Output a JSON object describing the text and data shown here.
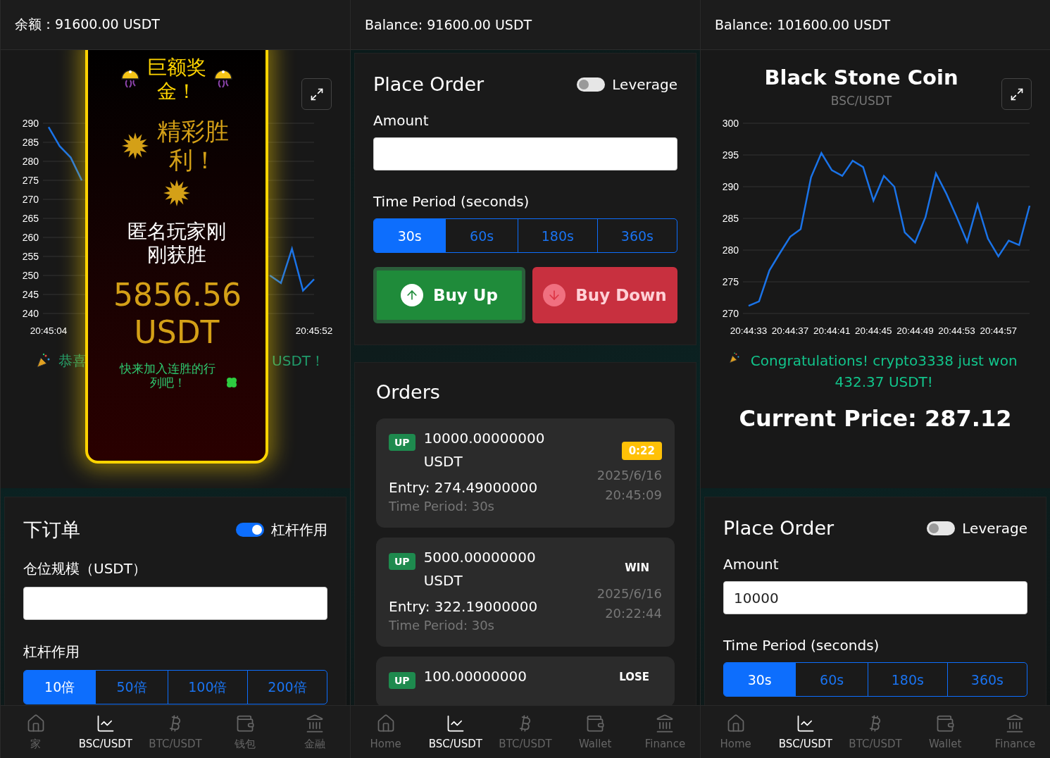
{
  "screens": [
    {
      "balance": "余额：91600.00 USDT",
      "market": {
        "chart_data": {
          "type": "line",
          "categories": [
            "20:45:04",
            null,
            null,
            null,
            null,
            null,
            null,
            null,
            null,
            null,
            null,
            null,
            null,
            null,
            null,
            null,
            null,
            null,
            null,
            null,
            null,
            null,
            null,
            null,
            "20:45:52"
          ],
          "series": [
            {
              "color": "#1a73e8",
              "values": [
                289,
                284,
                281,
                275,
                null,
                null,
                null,
                null,
                null,
                null,
                null,
                null,
                null,
                null,
                null,
                null,
                null,
                null,
                null,
                null,
                250,
                248,
                257,
                246,
                249
              ]
            }
          ],
          "grid": true,
          "ylim": [
            240,
            290
          ],
          "yticks": [
            240,
            245,
            250,
            255,
            260,
            265,
            270,
            275,
            280,
            285,
            290
          ]
        },
        "ticker": {
          "left": "恭喜",
          "right": "USDT！"
        }
      },
      "celebration": {
        "headline": "巨额奖金！",
        "subhead": "精彩胜利！",
        "message": "匿名玩家刚刚获胜",
        "amount": "5856.56 USDT",
        "cta": "快来加入连胜的行列吧！"
      },
      "order_form": {
        "title": "下订单",
        "toggle": {
          "label": "杠杆作用",
          "on": true
        },
        "amount_label": "仓位规模（USDT）",
        "options_label": "杠杆作用",
        "options": [
          {
            "label": "10倍",
            "selected": true
          },
          {
            "label": "50倍",
            "selected": false
          },
          {
            "label": "100倍",
            "selected": false
          },
          {
            "label": "200倍",
            "selected": false
          }
        ]
      },
      "nav": [
        {
          "label": "家",
          "selected": false
        },
        {
          "label": "BSC/USDT",
          "selected": true
        },
        {
          "label": "BTC/USDT",
          "selected": false
        },
        {
          "label": "钱包",
          "selected": false
        },
        {
          "label": "金融",
          "selected": false
        }
      ]
    },
    {
      "balance": "Balance: 91600.00 USDT",
      "order_form": {
        "title": "Place Order",
        "toggle": {
          "label": "Leverage",
          "on": false
        },
        "amount_label": "Amount",
        "options_label": "Time Period (seconds)",
        "options": [
          {
            "label": "30s",
            "selected": true
          },
          {
            "label": "60s",
            "selected": false
          },
          {
            "label": "180s",
            "selected": false
          },
          {
            "label": "360s",
            "selected": false
          }
        ],
        "actions": [
          {
            "label": "Buy Up",
            "kind": "up",
            "disabled": false
          },
          {
            "label": "Buy Down",
            "kind": "down",
            "disabled": true
          }
        ]
      },
      "orders": {
        "title": "Orders",
        "items": [
          {
            "direction": "UP",
            "amount": "10000.00000000 USDT",
            "entry": "Entry: 274.49000000",
            "period": "Time Period: 30s",
            "status": "0:22",
            "kind": "timer",
            "date": "2025/6/16",
            "time": "20:45:09"
          },
          {
            "direction": "UP",
            "amount": "5000.00000000 USDT",
            "entry": "Entry: 322.19000000",
            "period": "Time Period: 30s",
            "status": "WIN",
            "kind": "result",
            "date": "2025/6/16",
            "time": "20:22:44"
          },
          {
            "direction": "UP",
            "amount": "100.00000000",
            "status": "LOSE",
            "kind": "result"
          }
        ]
      },
      "nav": [
        {
          "label": "Home",
          "selected": false
        },
        {
          "label": "BSC/USDT",
          "selected": true
        },
        {
          "label": "BTC/USDT",
          "selected": false
        },
        {
          "label": "Wallet",
          "selected": false
        },
        {
          "label": "Finance",
          "selected": false
        }
      ]
    },
    {
      "balance": "Balance: 101600.00 USDT",
      "market": {
        "title": "Black Stone Coin",
        "subtitle": "BSC/USDT",
        "chart_data": {
          "type": "line",
          "categories": [
            "20:44:33",
            null,
            null,
            null,
            "20:44:37",
            null,
            null,
            null,
            "20:44:41",
            null,
            null,
            null,
            "20:44:45",
            null,
            null,
            null,
            "20:44:49",
            null,
            null,
            null,
            "20:44:53",
            null,
            null,
            null,
            "20:44:57",
            null,
            null,
            null
          ],
          "series": [
            {
              "color": "#1a73e8",
              "values": [
                271.2,
                271.9,
                276.8,
                279.5,
                282.1,
                283.3,
                291.5,
                295.3,
                292.6,
                291.7,
                294.1,
                293.1,
                287.8,
                291.7,
                290.0,
                282.8,
                281.2,
                285.2,
                292.1,
                288.9,
                285.2,
                281.3,
                287.2,
                281.8,
                279.0,
                281.5,
                280.8,
                287.0
              ]
            }
          ],
          "grid": true,
          "ylim": [
            270,
            300
          ],
          "yticks": [
            270,
            275,
            280,
            285,
            290,
            295,
            300
          ]
        },
        "ticker": {
          "text": "Congratulations! crypto3338 just won 432.37 USDT!"
        },
        "price": "Current Price: 287.12"
      },
      "order_form": {
        "title": "Place Order",
        "toggle": {
          "label": "Leverage",
          "on": false
        },
        "amount_label": "Amount",
        "amount_value": "10000",
        "options_label": "Time Period (seconds)",
        "options": [
          {
            "label": "30s",
            "selected": true
          },
          {
            "label": "60s",
            "selected": false
          },
          {
            "label": "180s",
            "selected": false
          },
          {
            "label": "360s",
            "selected": false
          }
        ]
      },
      "nav": [
        {
          "label": "Home",
          "selected": false
        },
        {
          "label": "BSC/USDT",
          "selected": true
        },
        {
          "label": "BTC/USDT",
          "selected": false
        },
        {
          "label": "Wallet",
          "selected": false
        },
        {
          "label": "Finance",
          "selected": false
        }
      ]
    }
  ]
}
